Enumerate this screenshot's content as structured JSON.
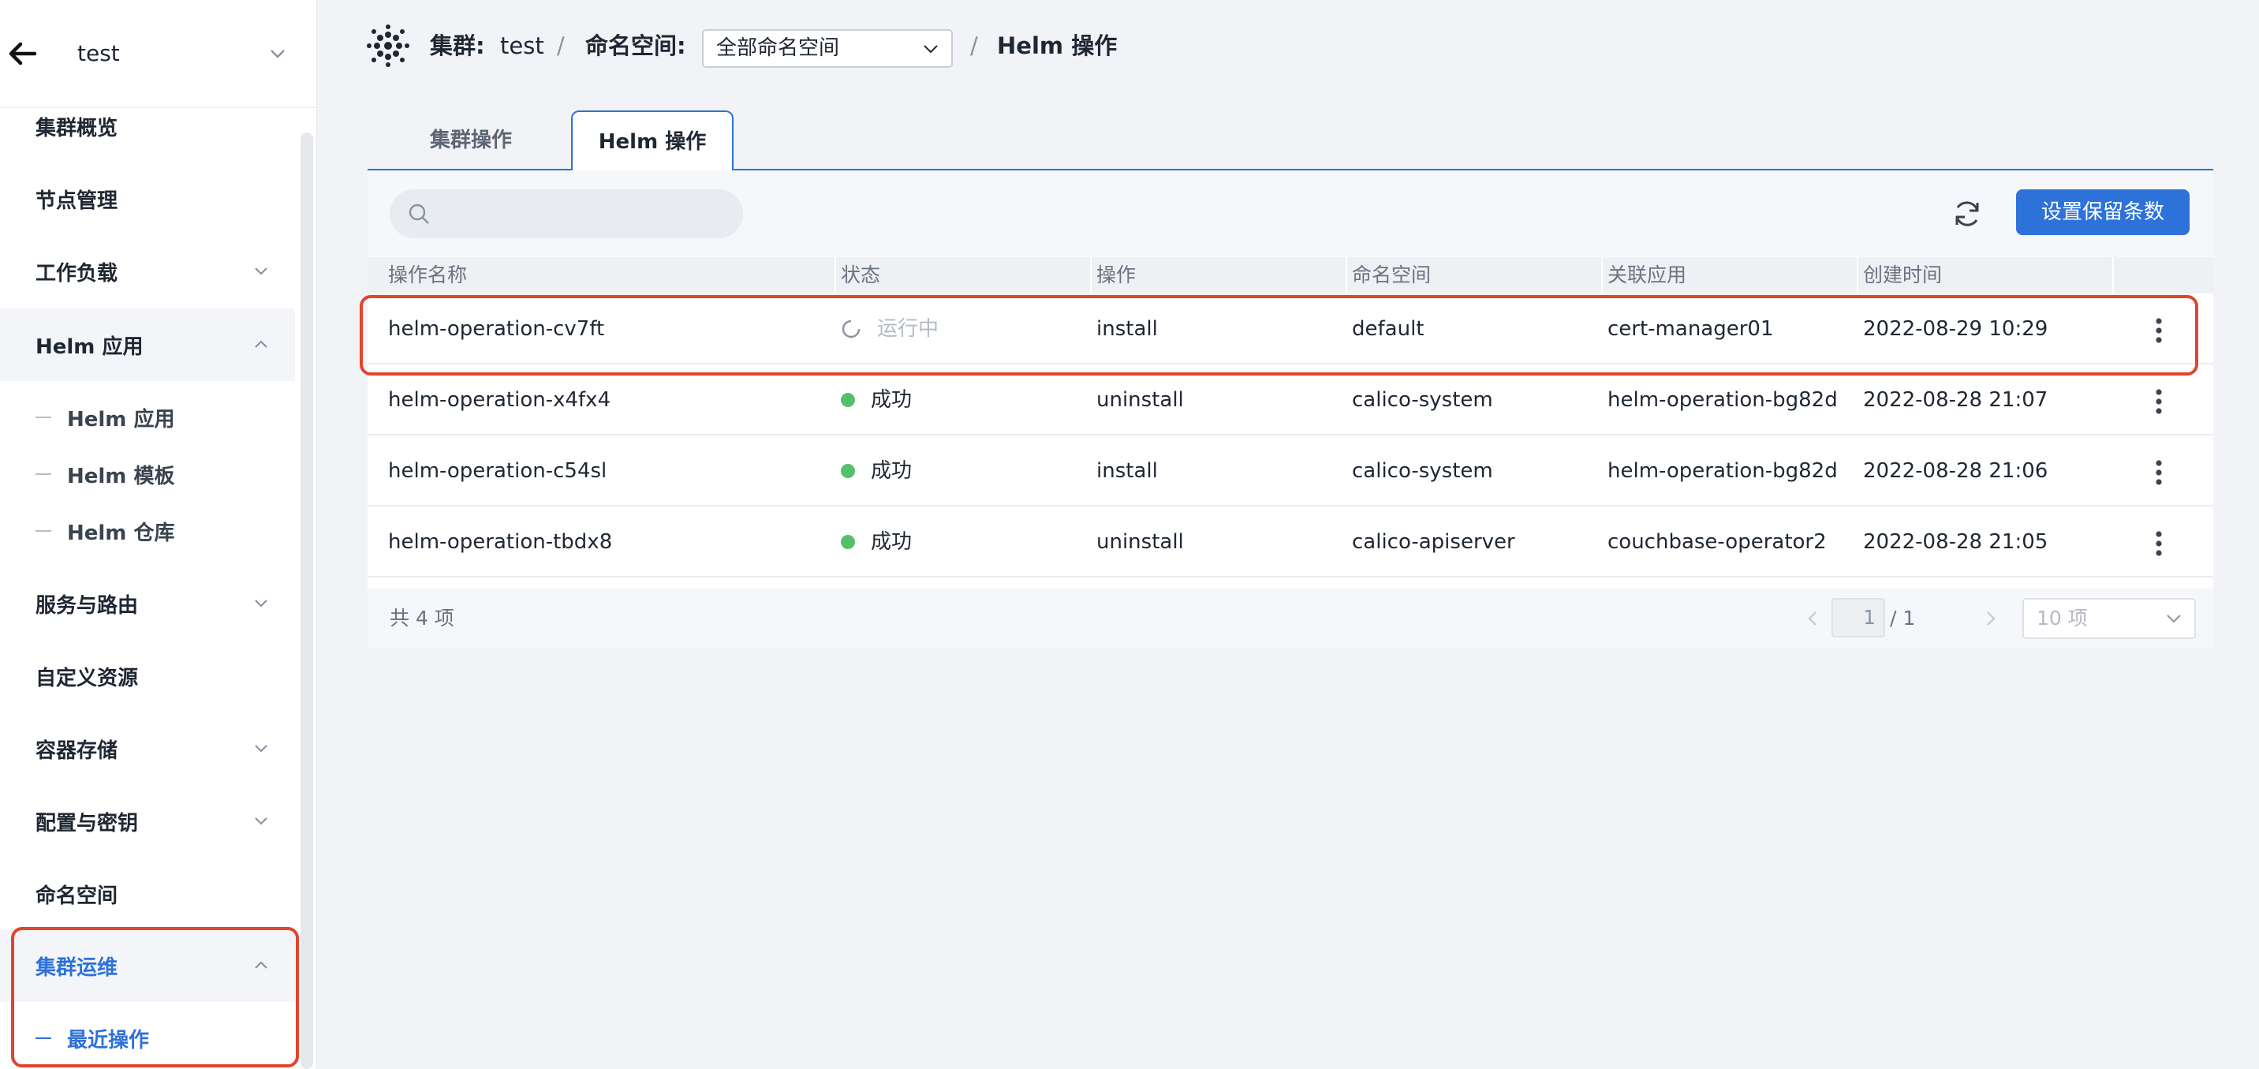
{
  "sidebar": {
    "cluster_name": "test",
    "items": [
      {
        "label": "集群概览"
      },
      {
        "label": "节点管理"
      },
      {
        "label": "工作负载"
      },
      {
        "label": "Helm 应用"
      },
      {
        "label": "服务与路由"
      },
      {
        "label": "自定义资源"
      },
      {
        "label": "容器存储"
      },
      {
        "label": "配置与密钥"
      },
      {
        "label": "命名空间"
      },
      {
        "label": "集群运维"
      }
    ],
    "helm_sub": [
      {
        "label": "Helm 应用"
      },
      {
        "label": "Helm 模板"
      },
      {
        "label": "Helm 仓库"
      }
    ],
    "ops_sub": [
      {
        "label": "最近操作"
      }
    ]
  },
  "header": {
    "cluster_label": "集群:",
    "cluster_value": "test",
    "separator": "/",
    "namespace_label": "命名空间:",
    "namespace_value": "全部命名空间",
    "page_title": "Helm 操作"
  },
  "tabs": [
    {
      "label": "集群操作"
    },
    {
      "label": "Helm 操作"
    }
  ],
  "toolbar": {
    "search_placeholder": "",
    "retain_button": "设置保留条数"
  },
  "table": {
    "columns": [
      "操作名称",
      "状态",
      "操作",
      "命名空间",
      "关联应用",
      "创建时间"
    ],
    "rows": [
      {
        "name": "helm-operation-cv7ft",
        "status": "运行中",
        "action": "install",
        "namespace": "default",
        "app": "cert-manager01",
        "created": "2022-08-29 10:29"
      },
      {
        "name": "helm-operation-x4fx4",
        "status": "成功",
        "action": "uninstall",
        "namespace": "calico-system",
        "app": "helm-operation-bg82d",
        "created": "2022-08-28 21:07"
      },
      {
        "name": "helm-operation-c54sl",
        "status": "成功",
        "action": "install",
        "namespace": "calico-system",
        "app": "helm-operation-bg82d",
        "created": "2022-08-28 21:06"
      },
      {
        "name": "helm-operation-tbdx8",
        "status": "成功",
        "action": "uninstall",
        "namespace": "calico-apiserver",
        "app": "couchbase-operator2",
        "created": "2022-08-28 21:05"
      }
    ]
  },
  "pagination": {
    "total": "共 4 项",
    "current_page": "1",
    "total_pages": "/ 1",
    "page_size": "10 项"
  },
  "colors": {
    "accent": "#2d72d9",
    "success": "#55c06c",
    "highlight": "#e0452d"
  }
}
